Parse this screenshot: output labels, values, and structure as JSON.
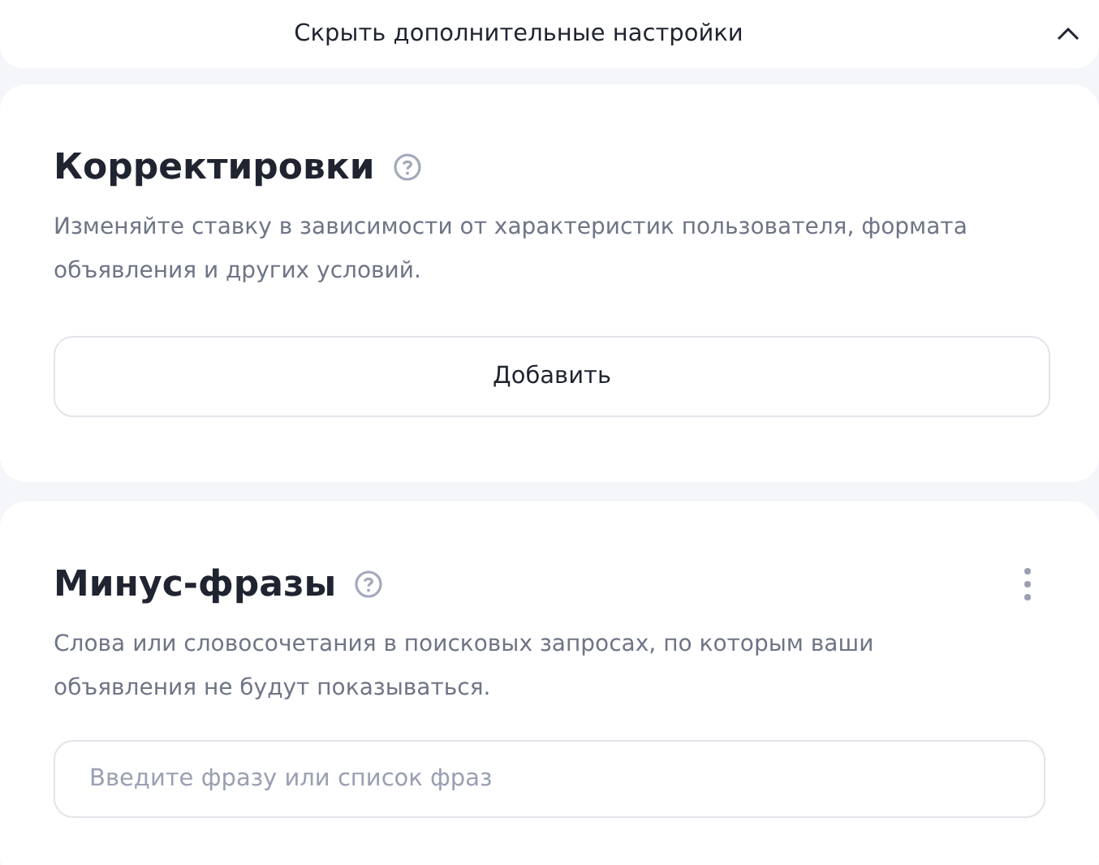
{
  "toggle": {
    "label": "Скрыть дополнительные настройки",
    "expanded": true
  },
  "sections": [
    {
      "kind": "button",
      "title": "Корректировки",
      "description": "Изменяйте ставку в зависимости от характеристик пользователя, формата объявления и других условий.",
      "action": "Добавить",
      "menu": false
    },
    {
      "kind": "input",
      "title": "Минус-фразы",
      "description": "Слова или словосочетания в поисковых запросах, по которым ваши объявления не будут показываться.",
      "placeholder": "Введите фразу или список фраз",
      "menu": true
    }
  ]
}
